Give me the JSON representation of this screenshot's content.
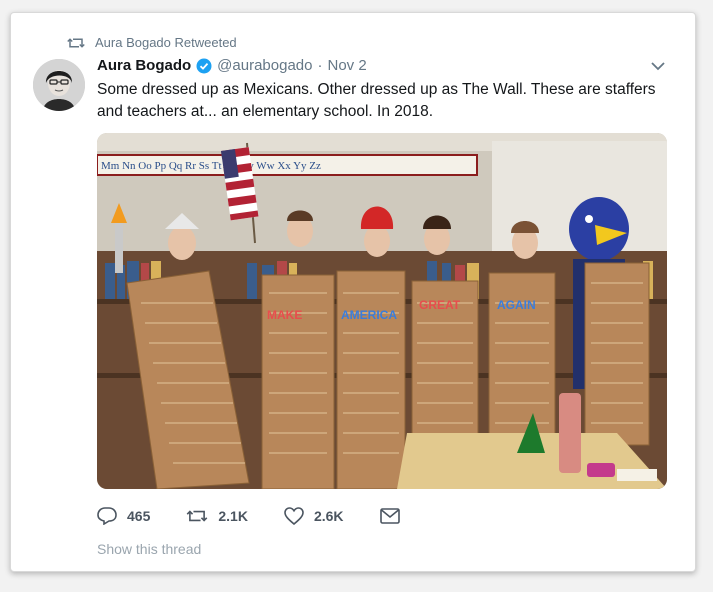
{
  "retweet_header": {
    "text": "Aura Bogado Retweeted"
  },
  "tweet": {
    "author_name": "Aura Bogado",
    "handle": "@aurabogado",
    "separator": "·",
    "date": "Nov 2",
    "text": "Some dressed up as Mexicans. Other dressed up as The Wall. These are staffers and teachers at... an elementary school. In 2018."
  },
  "photo": {
    "alphabet_strip": "Mm  Nn  Oo  Pp  Qq  Rr  Ss  Tt  Uu  Vv  Ww  Xx  Yy  Zz",
    "wall_letters": [
      "MAKE",
      "AMERICA",
      "GREAT",
      "AGAIN"
    ]
  },
  "actions": {
    "replies": "465",
    "retweets": "2.1K",
    "likes": "2.6K"
  },
  "show_thread": "Show this thread",
  "colors": {
    "text": "#14171a",
    "muted": "#657786",
    "verified": "#1da1f2",
    "wall": "#b8875a"
  },
  "icons": [
    "retweet-icon",
    "verified-icon",
    "chevron-down-icon",
    "reply-icon",
    "heart-icon",
    "dm-icon"
  ]
}
